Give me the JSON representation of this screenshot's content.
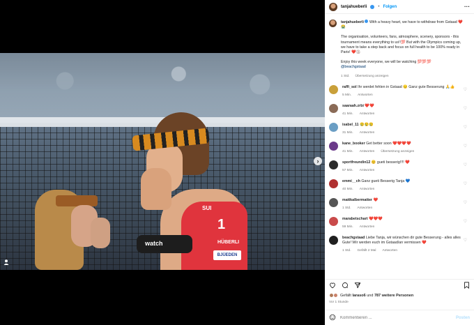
{
  "post": {
    "username": "tanjahueberli",
    "follow_label": "Folgen",
    "more_icon": "more-horizontal-icon",
    "caption_p1": "With a heavy heart, we have to withdraw from Gstaad ❤️😭",
    "caption_p2": "The organisation, volunteers, fans, atmosphere, scenery, sponsors - this tournament means everything to us!!💯 But with the Olympics coming up, we have to take a step back and focus on full health to be 100% ready in Paris! ❤️🏐",
    "caption_p3": "Enjoy this week everyone, we will be watching 💯💯💯",
    "caption_mention": "@beachgstaad",
    "caption_time": "1 Std.",
    "caption_translate": "Übersetzung anzeigen",
    "jersey_number": "1",
    "jersey_tag": "SUI",
    "jersey_name": "HÜBERLI",
    "jersey_sponsor": "BJÜEDEN",
    "armband_text": "watch"
  },
  "comments": [
    {
      "user": "raffi_sol",
      "text": "Ihr werdet fehlen in Gstaad 😔 Ganz gute Besserung 🙏👍",
      "time": "5 Min.",
      "reply": "Antworten",
      "translate": "",
      "color": "#c9a03a"
    },
    {
      "user": "saaraah.zrbi",
      "text": "❤️❤️",
      "time": "41 Min.",
      "reply": "Antworten",
      "translate": "",
      "color": "#8a6b57"
    },
    {
      "user": "isabel_11",
      "text": "😢😢😢",
      "time": "31 Min.",
      "reply": "Antworten",
      "translate": "",
      "color": "#6a9ec4"
    },
    {
      "user": "kane_booker",
      "text": "Get better soon ❤️❤️❤️❤️",
      "time": "41 Min.",
      "reply": "Antworten",
      "translate": "Übersetzung anzeigen",
      "color": "#6b3a8a"
    },
    {
      "user": "sportfreundin12",
      "text": "😊 gueti besserig!!!! ❤️",
      "time": "57 Min.",
      "reply": "Antworten",
      "translate": "",
      "color": "#2a2a2a"
    },
    {
      "user": "emmi__ch",
      "text": "Ganz gueti Besserig Tanja 💙",
      "time": "40 Min.",
      "reply": "Antworten",
      "translate": "",
      "color": "#b03030"
    },
    {
      "user": "mattkalbermatter",
      "text": "❤️",
      "time": "1 Std.",
      "reply": "Antworten",
      "translate": "",
      "color": "#555555"
    },
    {
      "user": "marabetschart",
      "text": "❤️❤️❤️",
      "time": "59 Min.",
      "reply": "Antworten",
      "translate": "",
      "color": "#c94a4a"
    },
    {
      "user": "beachgstaad",
      "text": "Liebe Tanja, wir wünschen dir gute Besserung - alles alles Gute! Wir werden euch im Gstaad/an vermissen ❤️",
      "time": "1 Std.",
      "reply": "Antworten",
      "translate": "",
      "likes": "Gefällt 2 Mal",
      "color": "#1f1f1f"
    }
  ],
  "actions": {
    "like_icon": "heart-icon",
    "comment_icon": "comment-icon",
    "share_icon": "send-icon",
    "save_icon": "bookmark-icon"
  },
  "likes": {
    "prefix": "Gefällt ",
    "user": "laraso6",
    "middle": " und ",
    "count": "787 weitere Personen"
  },
  "time_ago": "Vor 1 Stunde",
  "comment_box": {
    "placeholder": "Kommentieren ...",
    "post_label": "Posten"
  }
}
